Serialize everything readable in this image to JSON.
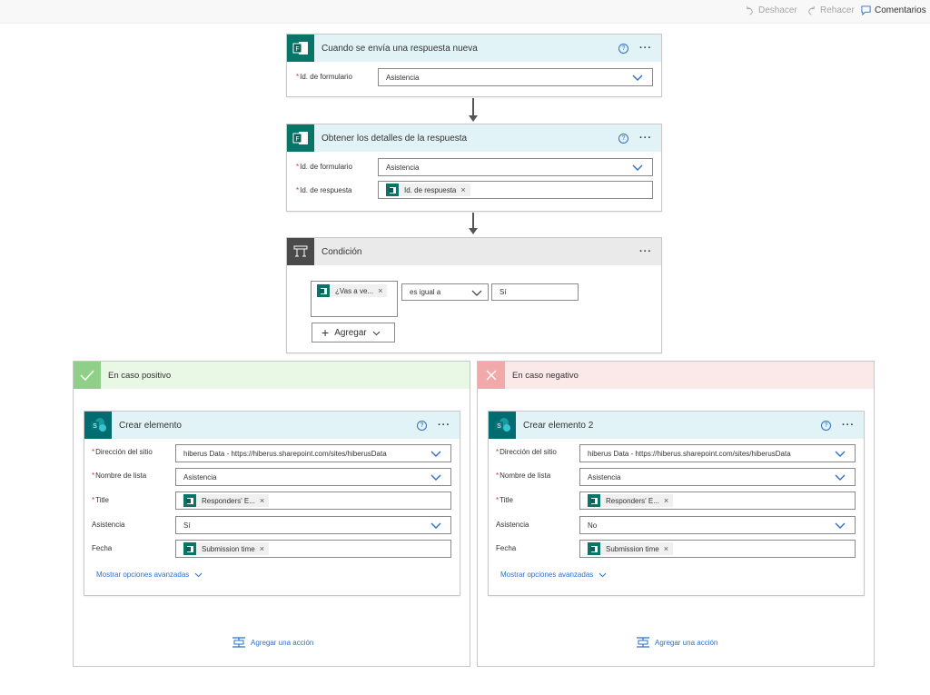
{
  "toolbar": {
    "undo": "Deshacer",
    "redo": "Rehacer",
    "comments": "Comentarios"
  },
  "trigger": {
    "title": "Cuando se envía una respuesta nueva",
    "form_id_label": "Id. de formulario",
    "form_id_value": "Asistencia"
  },
  "details": {
    "title": "Obtener los detalles de la respuesta",
    "form_id_label": "Id. de formulario",
    "form_id_value": "Asistencia",
    "response_id_label": "Id. de respuesta",
    "response_id_token": "Id. de respuesta"
  },
  "condition": {
    "title": "Condición",
    "left_token": "¿Vas a ve...",
    "operator": "es igual a",
    "value": "Sí",
    "add_button": "Agregar"
  },
  "yes_branch": {
    "title": "En caso positivo",
    "action": {
      "title": "Crear elemento",
      "site_label": "Dirección del sitio",
      "site_value": "hiberus Data - https://hiberus.sharepoint.com/sites/hiberusData",
      "list_label": "Nombre de lista",
      "list_value": "Asistencia",
      "title_label": "Title",
      "title_token": "Responders' E...",
      "attendance_label": "Asistencia",
      "attendance_value": "Sí",
      "date_label": "Fecha",
      "date_token": "Submission time",
      "advanced": "Mostrar opciones avanzadas"
    },
    "add_action": "Agregar una acción"
  },
  "no_branch": {
    "title": "En caso negativo",
    "action": {
      "title": "Crear elemento 2",
      "site_label": "Dirección del sitio",
      "site_value": "hiberus Data - https://hiberus.sharepoint.com/sites/hiberusData",
      "list_label": "Nombre de lista",
      "list_value": "Asistencia",
      "title_label": "Title",
      "title_token": "Responders' E...",
      "attendance_label": "Asistencia",
      "attendance_value": "No",
      "date_label": "Fecha",
      "date_token": "Submission time",
      "advanced": "Mostrar opciones avanzadas"
    },
    "add_action": "Agregar una acción"
  },
  "colors": {
    "forms_green": "#077568",
    "sharepoint_teal": "#036c70",
    "link_blue": "#2e6fc9",
    "required_red": "#d13438"
  }
}
